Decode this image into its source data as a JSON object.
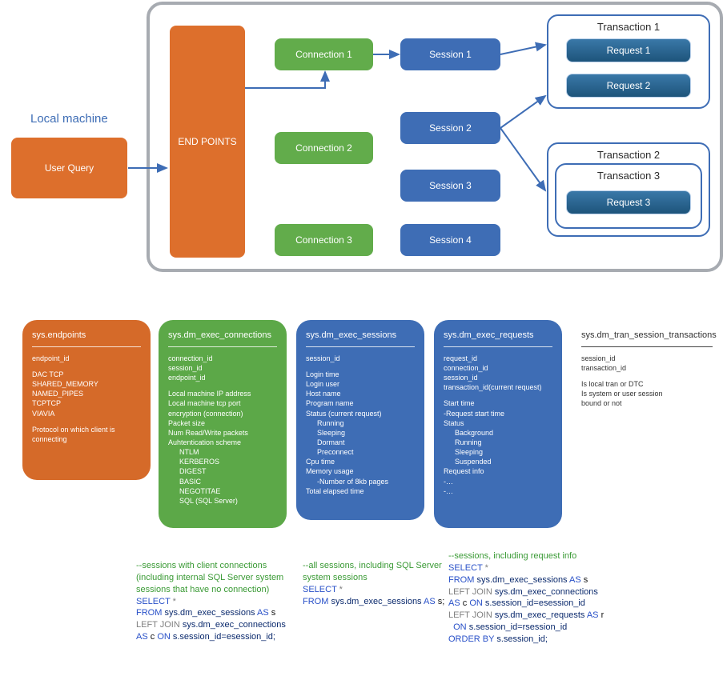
{
  "local_label": "Local machine",
  "user_query": "User Query",
  "endpoints": "END POINTS",
  "connections": [
    "Connection 1",
    "Connection 2",
    "Connection 3"
  ],
  "sessions": [
    "Session 1",
    "Session 2",
    "Session 3",
    "Session 4"
  ],
  "tx1": {
    "title": "Transaction 1",
    "req1": "Request 1",
    "req2": "Request 2"
  },
  "tx2": {
    "title": "Transaction 2"
  },
  "tx3": {
    "title": "Transaction 3",
    "req3": "Request 3"
  },
  "card_endpoints": {
    "title": "sys.endpoints",
    "l1": "endpoint_id",
    "l2": "DAC TCP",
    "l3": "SHARED_MEMORY",
    "l4": "NAMED_PIPES",
    "l5": "TCPTCP",
    "l6": "VIAVIA",
    "l7": "Protocol on which client is connecting"
  },
  "card_conn": {
    "title": "sys.dm_exec_connections",
    "l1": "connection_id",
    "l2": "session_id",
    "l3": "endpoint_id",
    "l4": "Local machine IP address",
    "l5": "Local machine tcp port",
    "l6": "encryption (connection)",
    "l7": "Packet size",
    "l8": "Num Read/Write packets",
    "l9": "Auhtentication scheme",
    "l10": "NTLM",
    "l11": "KERBEROS",
    "l12": "DIGEST",
    "l13": "BASIC",
    "l14": "NEGOTITAE",
    "l15": "SQL (SQL Server)"
  },
  "card_sess": {
    "title": "sys.dm_exec_sessions",
    "l1": "session_id",
    "l2": "Login time",
    "l3": "Login user",
    "l4": "Host name",
    "l5": "Program name",
    "l6": "Status (current request)",
    "l7": "Running",
    "l8": "Sleeping",
    "l9": "Dormant",
    "l10": "Preconnect",
    "l11": "Cpu time",
    "l12": "Memory usage",
    "l13": "-Number of 8kb pages",
    "l14": "Total elapsed time"
  },
  "card_req": {
    "title": "sys.dm_exec_requests",
    "l1": "request_id",
    "l2": "connection_id",
    "l3": "session_id",
    "l4": "transaction_id(current request)",
    "l5": "Start time",
    "l6": "-Request start time",
    "l7": "Status",
    "l8": "Background",
    "l9": "Running",
    "l10": "Sleeping",
    "l11": "Suspended",
    "l12": "Request info",
    "l13": "-…",
    "l14": "-…"
  },
  "card_tran": {
    "title": "sys.dm_tran_session_transactions",
    "l1": "session_id",
    "l2": "transaction_id",
    "l3": "Is local tran or DTC",
    "l4": "Is system or user session",
    "l5": "bound or not"
  },
  "q1": {
    "c1": "--sessions with client connections (including internal SQL Server system sessions that have no connection)",
    "sel": "SELECT",
    "star": " *",
    "from": "FROM",
    "t1": " sys.dm_exec_sessions",
    "as1": "AS",
    "a1": " s",
    "lj": "LEFT JOIN",
    "t2": " sys.dm_exec_connections",
    "as2": "AS",
    "a2": " c ",
    "on": "ON",
    "cond": " s.session_id=esession_id;"
  },
  "q2": {
    "c1": "--all sessions, including SQL Server system sessions",
    "sel": "SELECT",
    "star": " *",
    "from": "FROM",
    "t1": " sys.dm_exec_sessions",
    "as1": "AS",
    "a1": " s;"
  },
  "q3": {
    "c1": "--sessions, including request info",
    "sel": "SELECT",
    "star": " *",
    "from": "FROM",
    "t1": " sys.dm_exec_sessions",
    "as1": "AS",
    "a1": " s",
    "lj1": "LEFT JOIN",
    "t2": " sys.dm_exec_connections",
    "as2": "AS",
    "a2": " c ",
    "on1": "ON",
    "cond1": " s.session_id=esession_id",
    "lj2": "LEFT JOIN",
    "t3": " sys.dm_exec_requests",
    "as3": "AS",
    "a3": " r",
    "on2": "ON",
    "cond2": " s.session_id=rsession_id",
    "ob": "ORDER BY",
    "ob1": " s.session_id;"
  }
}
